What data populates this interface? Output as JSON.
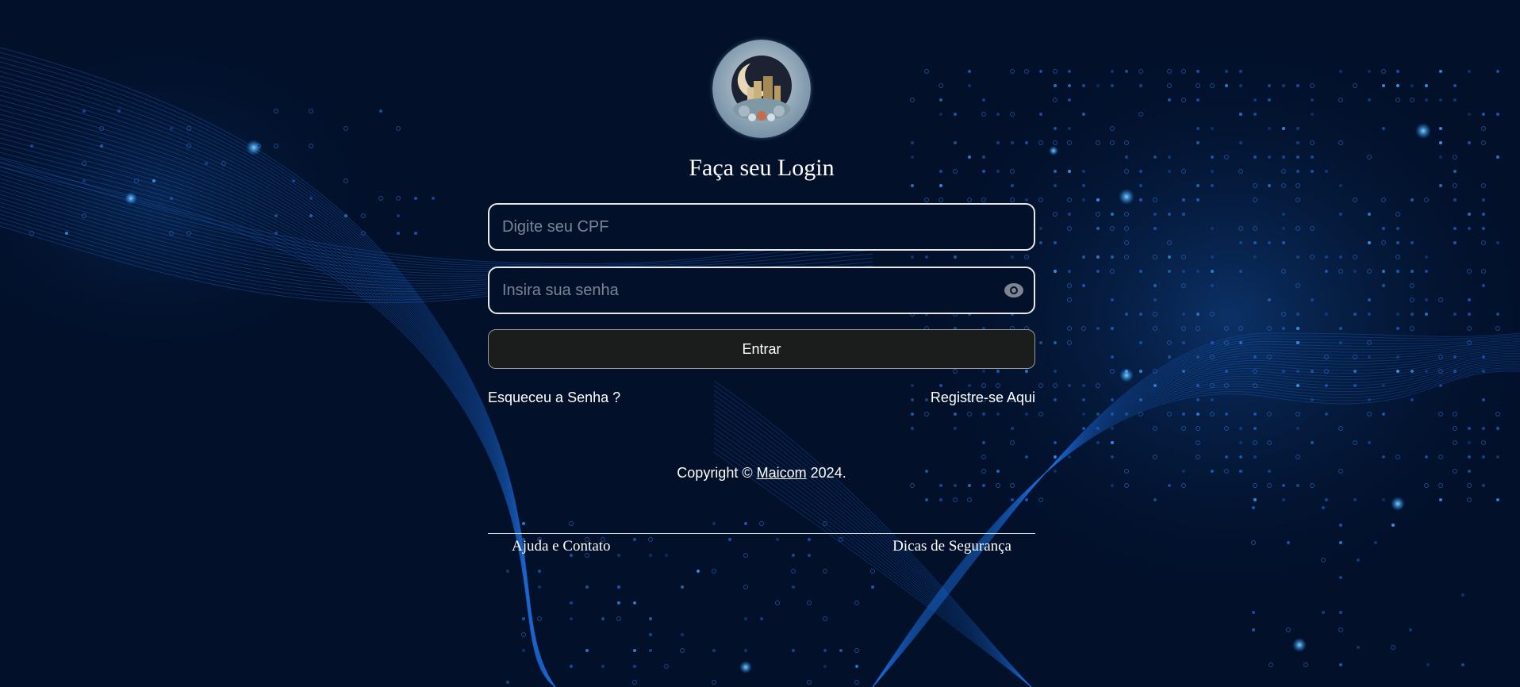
{
  "login": {
    "title": "Faça seu Login",
    "cpf_placeholder": "Digite seu CPF",
    "password_placeholder": "Insira sua senha",
    "submit_label": "Entrar",
    "forgot_label": "Esqueceu a Senha ?",
    "register_label": "Registre-se Aqui"
  },
  "footer": {
    "copyright_prefix": "Copyright ©",
    "brand": "Maicom",
    "year_suffix": "2024.",
    "help_label": "Ajuda e Contato",
    "security_label": "Dicas de Segurança"
  },
  "colors": {
    "background": "#02102a",
    "accent_blue": "#1a8cff",
    "button_bg": "#1a1d1c",
    "field_border": "#e8e8e8"
  },
  "icons": {
    "logo": "moon-city-emblem",
    "password_toggle": "eye-icon"
  }
}
